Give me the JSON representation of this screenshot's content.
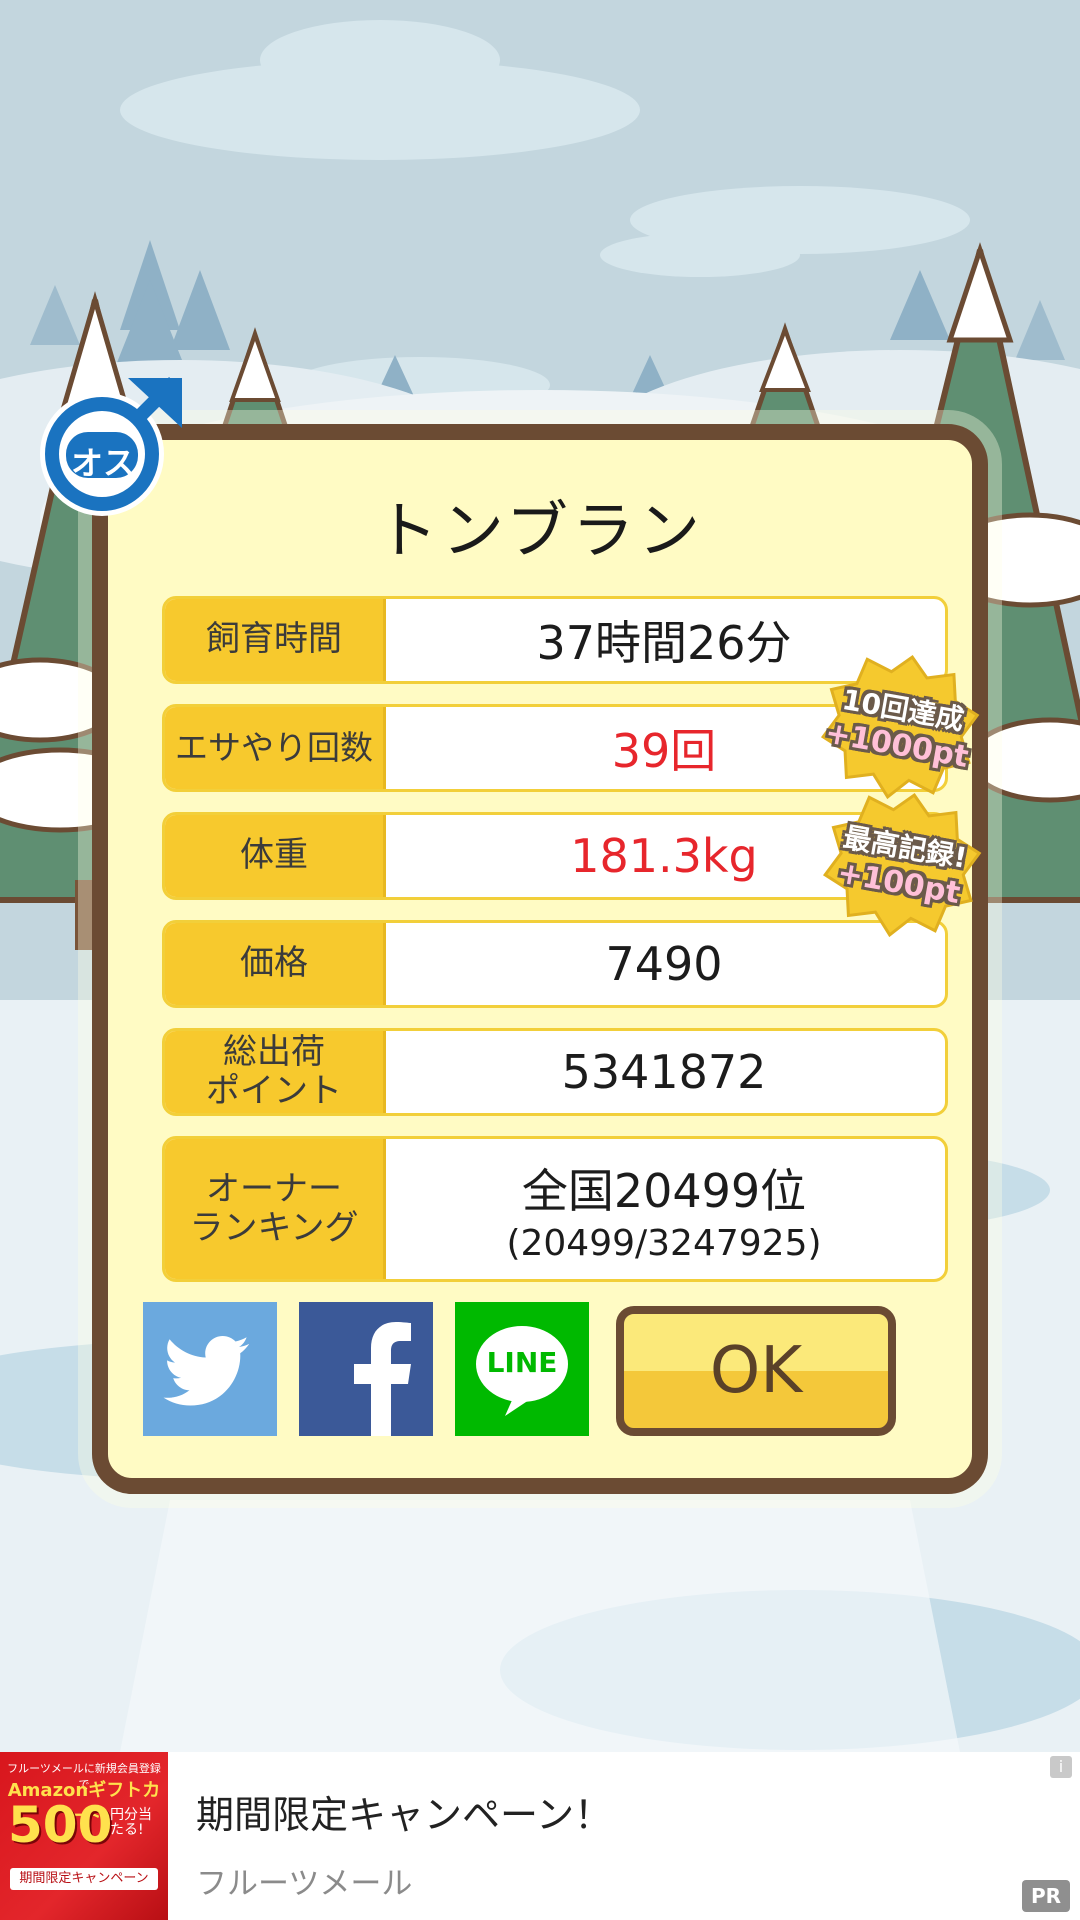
{
  "dialog": {
    "title": "トンブラン",
    "rows": [
      {
        "label": "飼育時間",
        "value": "37時間26分"
      },
      {
        "label": "エサやり回数",
        "value": "39回"
      },
      {
        "label": "体重",
        "value": "181.3kg"
      },
      {
        "label": "価格",
        "value": "7490"
      },
      {
        "label": "総出荷\nポイント",
        "value": "5341872"
      },
      {
        "label": "オーナー\nランキング",
        "value": "全国20499位",
        "sub": "(20499/3247925)"
      }
    ],
    "stickers": [
      {
        "line1": "10回達成",
        "line2": "+1000pt"
      },
      {
        "line1": "最高記録!",
        "line2": "+100pt"
      }
    ],
    "ok_label": "OK"
  },
  "badge": {
    "text": "オス",
    "icon": "male-symbol-icon"
  },
  "share": [
    {
      "icon": "twitter-icon",
      "color": "#6ba9de"
    },
    {
      "icon": "facebook-icon",
      "color": "#3b5998"
    },
    {
      "icon": "line-icon",
      "color": "#00b900",
      "text": "LINE"
    }
  ],
  "ad": {
    "image_lines": [
      "フルーツメールに新規会員登録で",
      "Amazonギフトカード",
      "500",
      "円分当たる!",
      "期間限定キャンペーン"
    ],
    "title": "期間限定キャンペーン！",
    "advertiser": "フルーツメール",
    "info": "i",
    "pr": "PR"
  },
  "colors": {
    "dialog_bg": "#fffbc4",
    "dialog_border": "#6b4b33",
    "label_bg": "#f7c92d",
    "highlight": "#e7262c"
  }
}
